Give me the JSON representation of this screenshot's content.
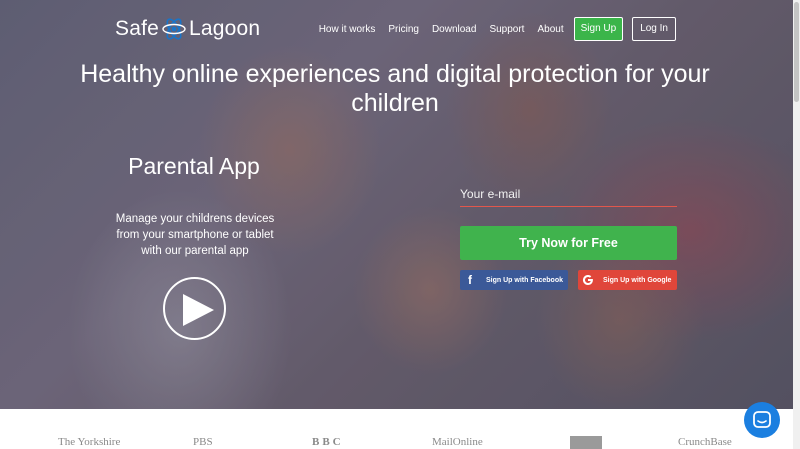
{
  "brand": {
    "name_left": "Safe",
    "name_right": "Lagoon"
  },
  "nav": {
    "items": [
      {
        "label": "How it works"
      },
      {
        "label": "Pricing"
      },
      {
        "label": "Download"
      },
      {
        "label": "Support"
      },
      {
        "label": "About"
      }
    ],
    "signup_label": "Sign Up",
    "login_label": "Log In"
  },
  "hero": {
    "headline": "Healthy online experiences and digital protection for your children",
    "app_title": "Parental App",
    "app_description": "Manage your childrens devices from your smartphone or tablet with our parental app",
    "play_icon": "play-icon",
    "email_placeholder": "Your e-mail",
    "email_value": "",
    "try_label": "Try Now for Free",
    "facebook_label": "Sign Up with Facebook",
    "google_label": "Sign Up with Google"
  },
  "press": {
    "logos": [
      {
        "text": "The Yorkshire"
      },
      {
        "text": "PBS"
      },
      {
        "text": "BBC"
      },
      {
        "text": "MailOnline"
      },
      {
        "text": ""
      },
      {
        "text": "CrunchBase"
      }
    ]
  },
  "colors": {
    "accent_green": "#40b34d",
    "facebook_blue": "#3b5998",
    "google_red": "#e0463a",
    "chat_blue": "#1b7fe0"
  },
  "chat": {
    "icon": "chat-bubble-icon"
  }
}
